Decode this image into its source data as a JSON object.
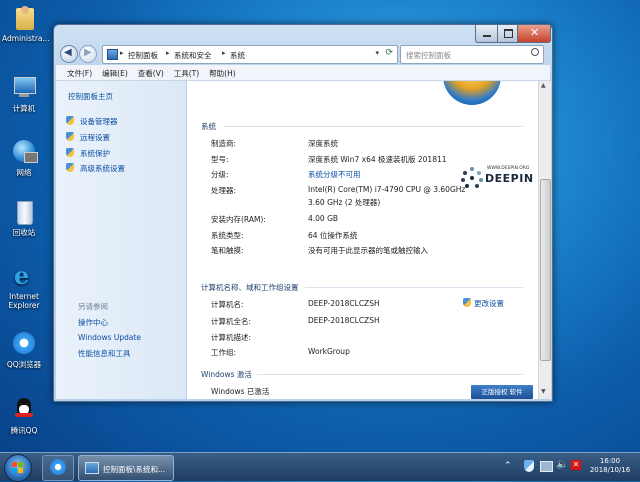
{
  "desktop": {
    "icons": [
      {
        "label": "Administra...",
        "icon": "user-folder-icon"
      },
      {
        "label": "计算机",
        "icon": "computer-icon"
      },
      {
        "label": "网络",
        "icon": "network-icon"
      },
      {
        "label": "回收站",
        "icon": "recycle-bin-icon"
      },
      {
        "label": "Internet Explorer",
        "icon": "ie-icon"
      },
      {
        "label": "QQ浏览器",
        "icon": "qq-browser-icon"
      },
      {
        "label": "腾讯QQ",
        "icon": "qq-icon"
      }
    ]
  },
  "window": {
    "breadcrumb": [
      "控制面板",
      "系统和安全",
      "系统"
    ],
    "search_placeholder": "搜索控制面板",
    "menu": [
      "文件(F)",
      "编辑(E)",
      "查看(V)",
      "工具(T)",
      "帮助(H)"
    ],
    "left": {
      "home": "控制面板主页",
      "links": [
        "设备管理器",
        "远程设置",
        "系统保护",
        "高级系统设置"
      ],
      "see_also_title": "另请参阅",
      "see_also": [
        "操作中心",
        "Windows Update",
        "性能信息和工具"
      ]
    },
    "system": {
      "title": "系统",
      "rows": [
        {
          "label": "制造商:",
          "value": "深度系统"
        },
        {
          "label": "型号:",
          "value": "深度系统 Win7 x64 极速装机版 201811"
        },
        {
          "label": "分级:",
          "value": "系统分级不可用"
        },
        {
          "label": "处理器:",
          "value": "Intel(R) Core(TM) i7-4790 CPU @ 3.60GHz",
          "value2": "3.60 GHz  (2 处理器)"
        },
        {
          "label": "安装内存(RAM):",
          "value": "4.00 GB"
        },
        {
          "label": "系统类型:",
          "value": "64 位操作系统"
        },
        {
          "label": "笔和触摸:",
          "value": "没有可用于此显示器的笔或触控输入"
        }
      ],
      "logo_text": "DEEPIN",
      "logo_url": "WWW.DEEPIN.ORG"
    },
    "computer": {
      "title": "计算机名称、域和工作组设置",
      "change_label": "更改设置",
      "rows": [
        {
          "label": "计算机名:",
          "value": "DEEP-2018CLCZSH"
        },
        {
          "label": "计算机全名:",
          "value": "DEEP-2018CLCZSH"
        },
        {
          "label": "计算机描述:",
          "value": ""
        },
        {
          "label": "工作组:",
          "value": "WorkGroup"
        }
      ]
    },
    "activation": {
      "title": "Windows 激活",
      "status": "Windows 已激活",
      "button": "正版授权 软件"
    }
  },
  "taskbar": {
    "task_label": "控制面板\\系统和...",
    "time": "16:00",
    "date": "2018/10/16"
  }
}
